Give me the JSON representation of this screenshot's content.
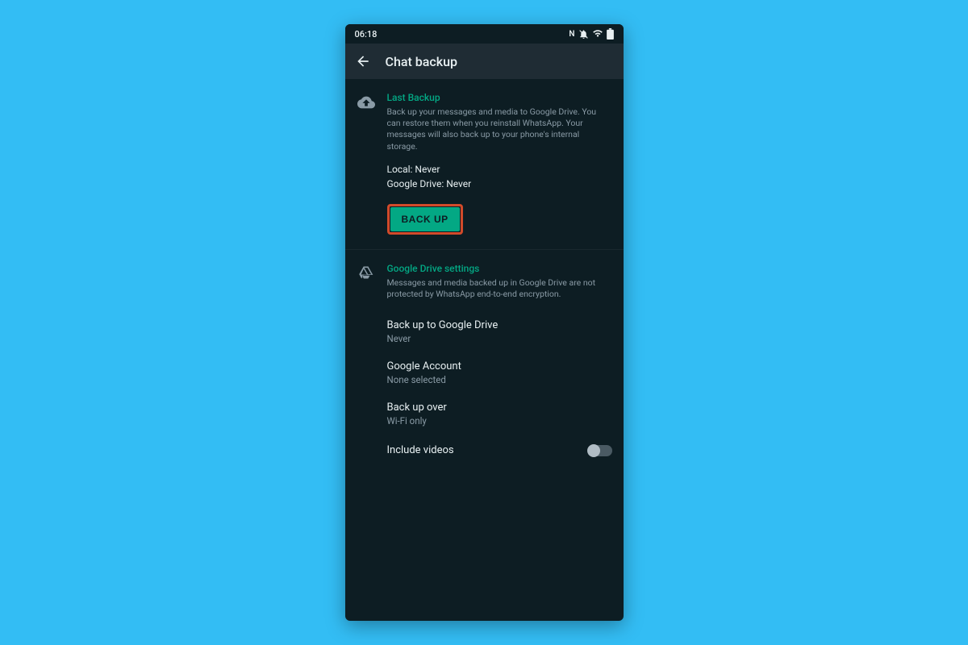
{
  "statusbar": {
    "time": "06:18"
  },
  "appbar": {
    "title": "Chat backup"
  },
  "last_backup": {
    "title": "Last Backup",
    "desc": "Back up your messages and media to Google Drive. You can restore them when you reinstall WhatsApp. Your messages will also back up to your phone's internal storage.",
    "local": "Local: Never",
    "gdrive": "Google Drive: Never",
    "button_label": "BACK UP"
  },
  "gdrive_settings": {
    "title": "Google Drive settings",
    "desc": "Messages and media backed up in Google Drive are not protected by WhatsApp end-to-end encryption.",
    "rows": [
      {
        "label": "Back up to Google Drive",
        "value": "Never"
      },
      {
        "label": "Google Account",
        "value": "None selected"
      },
      {
        "label": "Back up over",
        "value": "Wi-Fi only"
      }
    ],
    "include_videos_label": "Include videos",
    "include_videos_on": false
  }
}
